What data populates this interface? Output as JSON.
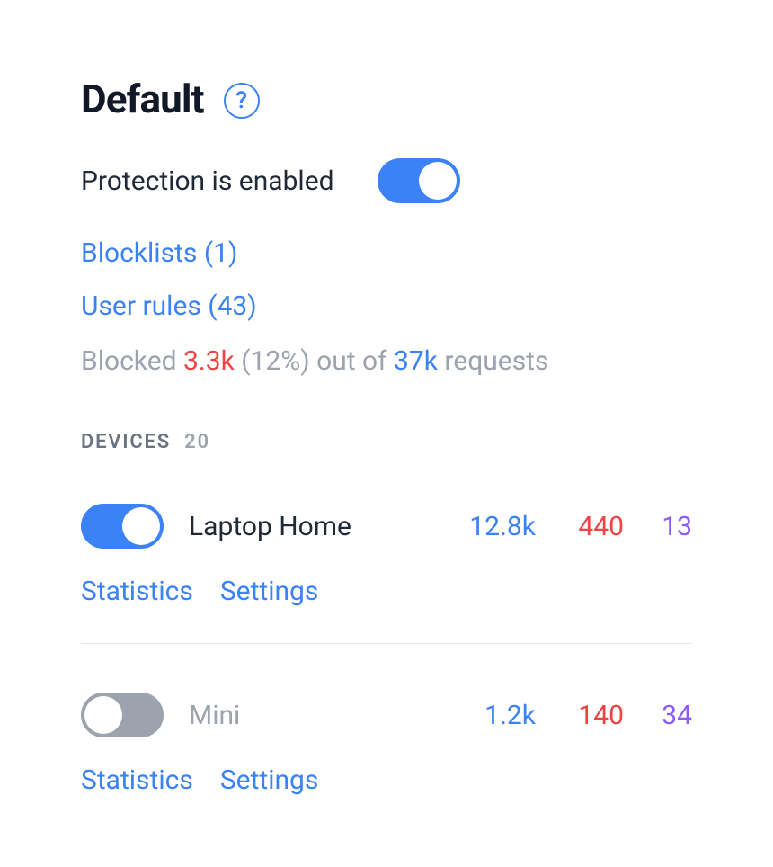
{
  "title": "Default",
  "help_glyph": "?",
  "protection": {
    "label": "Protection is enabled",
    "enabled": true
  },
  "links": {
    "blocklists": "Blocklists (1)",
    "user_rules": "User rules (43)"
  },
  "stats": {
    "prefix": "Blocked ",
    "blocked": "3.3k",
    "percent": " (12%) out of ",
    "total": "37k",
    "suffix": " requests"
  },
  "devices_section": {
    "label": "DEVICES",
    "count": "20"
  },
  "device_links": {
    "statistics": "Statistics",
    "settings": "Settings"
  },
  "devices": [
    {
      "name": "Laptop Home",
      "enabled": true,
      "requests": "12.8k",
      "blocked": "440",
      "other": "13"
    },
    {
      "name": "Mini",
      "enabled": false,
      "requests": "1.2k",
      "blocked": "140",
      "other": "34"
    }
  ]
}
